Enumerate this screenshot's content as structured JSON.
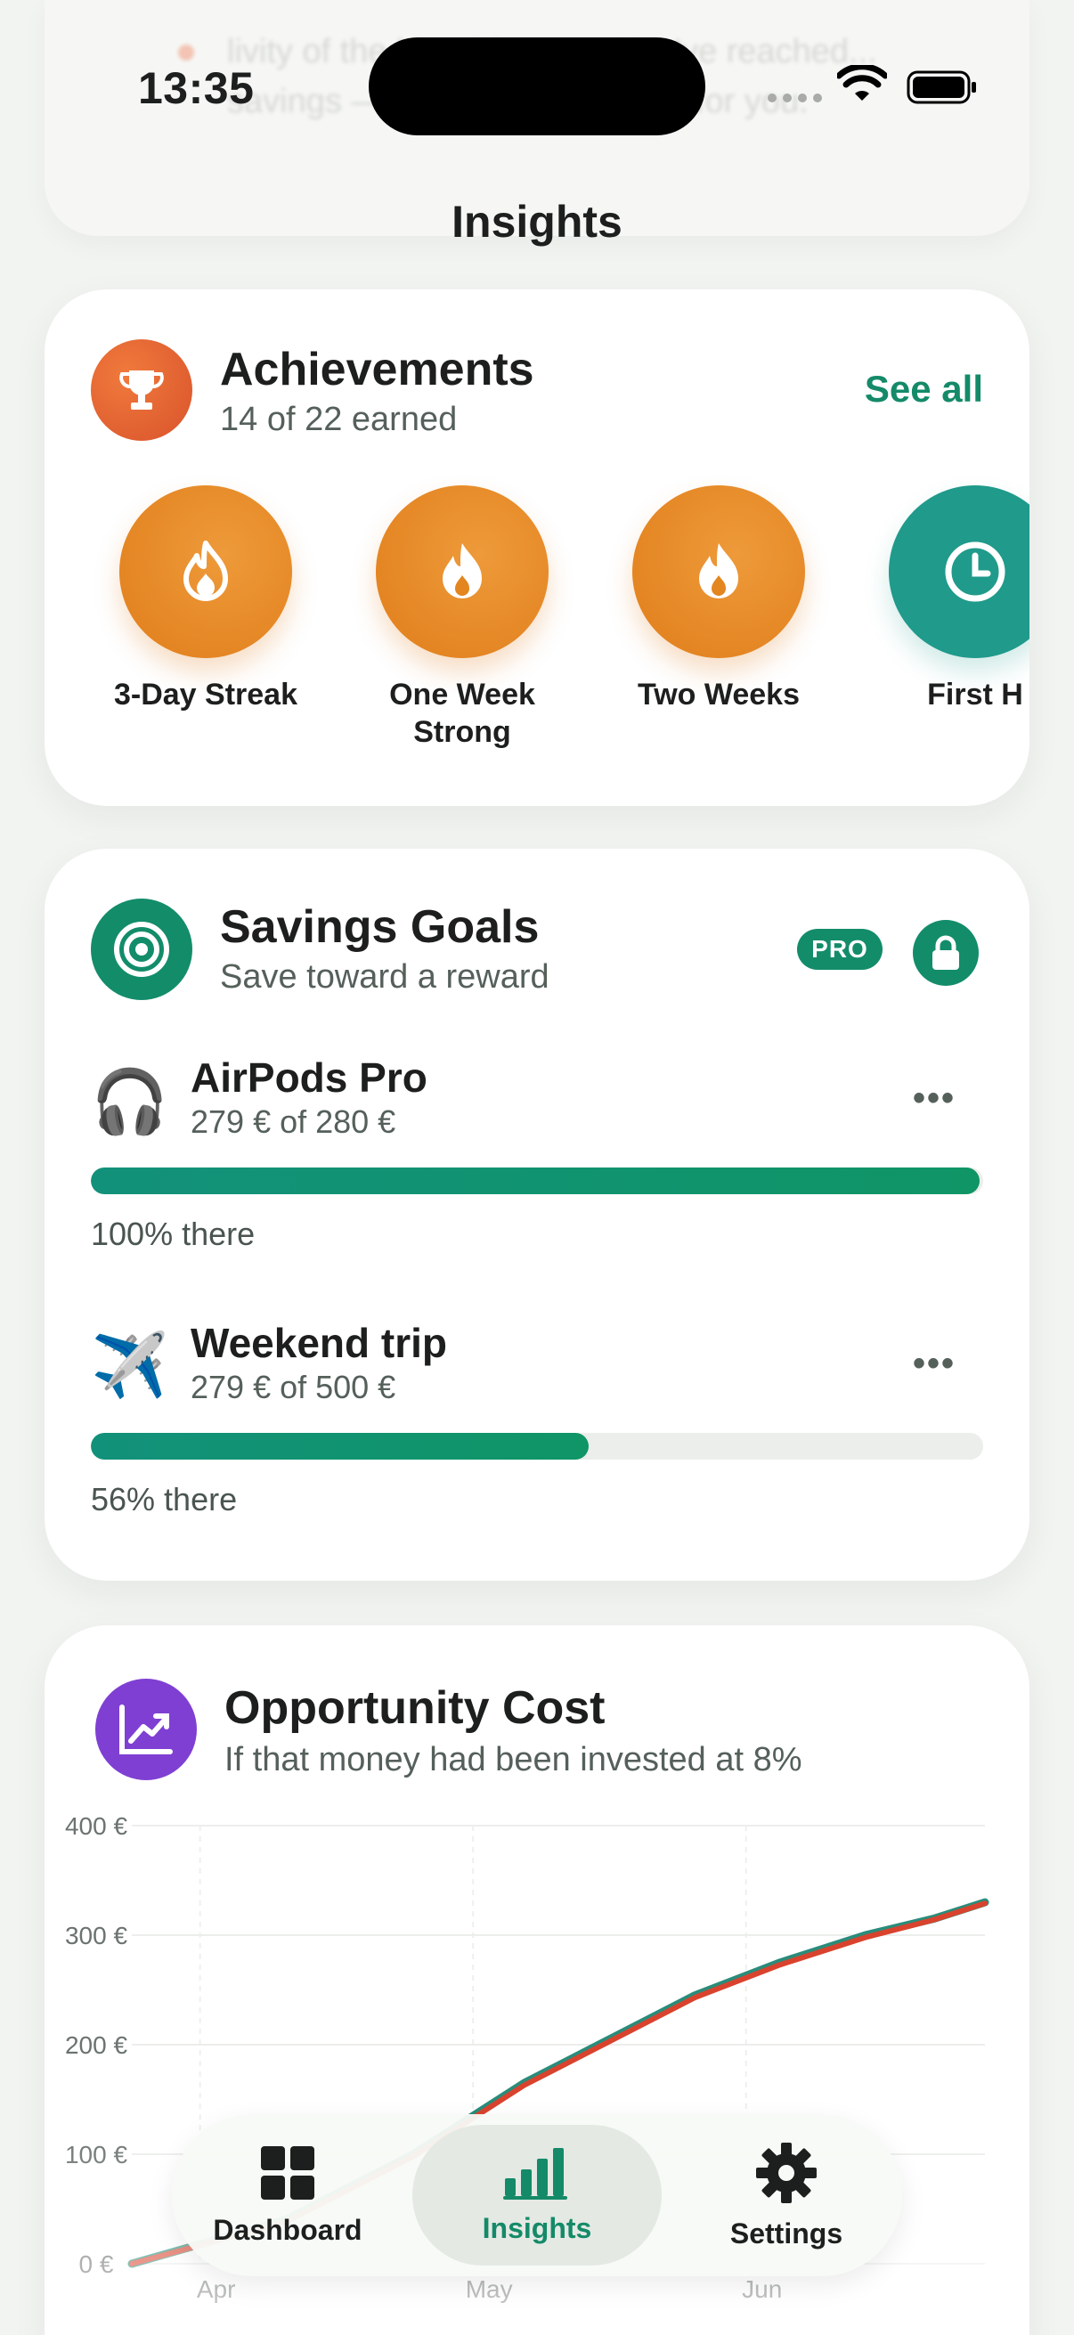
{
  "status": {
    "time": "13:35"
  },
  "ghost": {
    "text": "livity of the breathing cost  You've reached... savings — spending...  working for you."
  },
  "page": {
    "title": "Insights"
  },
  "achievements": {
    "title": "Achievements",
    "subtitle": "14 of 22 earned",
    "see_all": "See all",
    "badges": [
      {
        "label": "3-Day Streak",
        "icon": "flame-outline-icon"
      },
      {
        "label": "One Week Strong",
        "icon": "flame-icon"
      },
      {
        "label": "Two Weeks",
        "icon": "flame-icon"
      },
      {
        "label": "First H",
        "icon": "clock-icon"
      }
    ]
  },
  "savings": {
    "title": "Savings Goals",
    "subtitle": "Save toward a reward",
    "pro_label": "PRO",
    "goals": [
      {
        "emoji": "🎧",
        "name": "AirPods Pro",
        "amount": "279 € of 280 €",
        "percent_label": "100% there",
        "progress": 0.996
      },
      {
        "emoji": "✈️",
        "name": "Weekend trip",
        "amount": "279 € of 500 €",
        "percent_label": "56% there",
        "progress": 0.558
      }
    ],
    "more_label": "•••"
  },
  "opportunity": {
    "title": "Opportunity Cost",
    "subtitle": "If that money had been invested at 8%"
  },
  "chart_data": {
    "type": "line",
    "y_ticks": [
      "400 €",
      "300 €",
      "200 €",
      "100 €",
      "0 €"
    ],
    "x_ticks": [
      "Apr",
      "May",
      "Jun"
    ],
    "ylim": [
      0,
      400
    ],
    "series": [
      {
        "color": "#2a8c7a",
        "x": [
          0,
          0.18,
          0.33,
          0.46,
          0.56,
          0.66,
          0.76,
          0.86,
          0.94,
          1.0
        ],
        "y": [
          0,
          40,
          100,
          165,
          205,
          245,
          275,
          300,
          315,
          330
        ]
      },
      {
        "color": "#d9432e",
        "x": [
          0,
          0.18,
          0.33,
          0.46,
          0.56,
          0.66,
          0.76,
          0.86,
          0.94,
          1.0
        ],
        "y": [
          0,
          38,
          98,
          163,
          203,
          243,
          273,
          298,
          314,
          329
        ]
      }
    ],
    "grid": true
  },
  "tabs": [
    {
      "label": "Dashboard",
      "icon": "grid-icon"
    },
    {
      "label": "Insights",
      "icon": "bar-chart-icon"
    },
    {
      "label": "Settings",
      "icon": "gear-icon"
    }
  ]
}
